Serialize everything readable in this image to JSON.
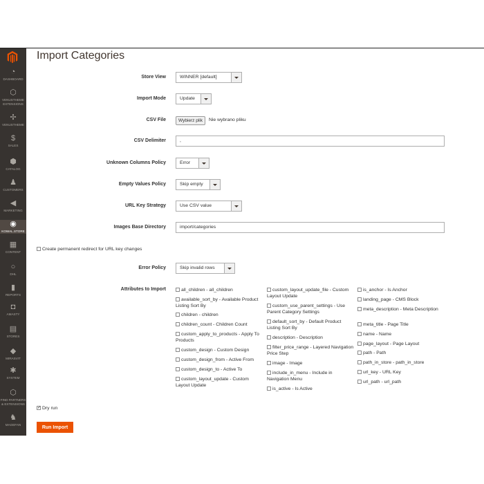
{
  "page": {
    "title": "Import Categories"
  },
  "sidebar": {
    "items": [
      {
        "icon": "dashboard-icon",
        "glyph": "◔",
        "label": "DASHBOARD"
      },
      {
        "icon": "venustheme-extensions-icon",
        "glyph": "⬡",
        "label": "VENUSTHEME EXTENSIONS"
      },
      {
        "icon": "venustheme-icon",
        "glyph": "✢",
        "label": "VENUSTHEME"
      },
      {
        "icon": "sales-icon",
        "glyph": "$",
        "label": "SALES"
      },
      {
        "icon": "catalog-icon",
        "glyph": "⬢",
        "label": "CATALOG"
      },
      {
        "icon": "customers-icon",
        "glyph": "♟",
        "label": "CUSTOMERS"
      },
      {
        "icon": "marketing-icon",
        "glyph": "◀",
        "label": "MARKETING"
      },
      {
        "icon": "kowal-store-icon",
        "glyph": "◉",
        "label": "KOWAL.STORE"
      },
      {
        "icon": "content-icon",
        "glyph": "▦",
        "label": "CONTENT"
      },
      {
        "icon": "dhl-icon",
        "glyph": "○",
        "label": "DHL"
      },
      {
        "icon": "reports-icon",
        "glyph": "▮",
        "label": "REPORTS"
      },
      {
        "icon": "amasty-icon",
        "glyph": "◘",
        "label": "AMASTY"
      },
      {
        "icon": "stores-icon",
        "glyph": "▤",
        "label": "STORES"
      },
      {
        "icon": "mirasvit-icon",
        "glyph": "◆",
        "label": "MIRASVIT"
      },
      {
        "icon": "system-icon",
        "glyph": "✱",
        "label": "SYSTEM"
      },
      {
        "icon": "find-partners-icon",
        "glyph": "⬡",
        "label": "FIND PARTNERS & EXTENSIONS"
      },
      {
        "icon": "magefan-icon",
        "glyph": "♞",
        "label": "MAGEFAN"
      }
    ]
  },
  "form": {
    "store_view": {
      "label": "Store View",
      "value": "WINNER [default]"
    },
    "import_mode": {
      "label": "Import Mode",
      "value": "Update"
    },
    "csv_file": {
      "label": "CSV File",
      "button": "Wybierz plik",
      "status": "Nie wybrano pliku"
    },
    "csv_delimiter": {
      "label": "CSV Delimiter",
      "value": ","
    },
    "unknown_columns": {
      "label": "Unknown Columns Policy",
      "value": "Error"
    },
    "empty_values": {
      "label": "Empty Values Policy",
      "value": "Skip empty"
    },
    "url_key_strategy": {
      "label": "URL Key Strategy",
      "value": "Use CSV value"
    },
    "images_base_dir": {
      "label": "Images Base Directory",
      "value": "import/categories"
    },
    "create_redirect": {
      "label": "Create permanent redirect for URL key changes",
      "checked": false
    },
    "error_policy": {
      "label": "Error Policy",
      "value": "Skip invalid rows"
    },
    "attributes_label": "Attributes to Import",
    "attributes_col1": [
      "all_children - all_children",
      "available_sort_by - Available Product Listing Sort By",
      "children - children",
      "children_count - Children Count",
      "custom_apply_to_products - Apply To Products",
      "custom_design - Custom Design",
      "custom_design_from - Active From",
      "custom_design_to - Active To",
      "custom_layout_update - Custom Layout Update"
    ],
    "attributes_col2": [
      "custom_layout_update_file - Custom Layout Update",
      "custom_use_parent_settings - Use Parent Category Settings",
      "default_sort_by - Default Product Listing Sort By",
      "description - Description",
      "filter_price_range - Layered Navigation Price Step",
      "image - Image",
      "include_in_menu - Include in Navigation Menu",
      "is_active - Is Active"
    ],
    "attributes_col3": [
      "is_anchor - Is Anchor",
      "landing_page - CMS Block",
      "meta_description - Meta Description",
      "meta_title - Page Title",
      "name - Name",
      "page_layout - Page Layout",
      "path - Path",
      "path_in_store - path_in_store",
      "url_key - URL Key",
      "url_path - url_path"
    ],
    "dry_run": {
      "label": "Dry run",
      "checked": true
    },
    "run_button": "Run Import"
  },
  "colors": {
    "sidebar": "#373330",
    "accent": "#eb5202",
    "logo": "#eb5202"
  }
}
